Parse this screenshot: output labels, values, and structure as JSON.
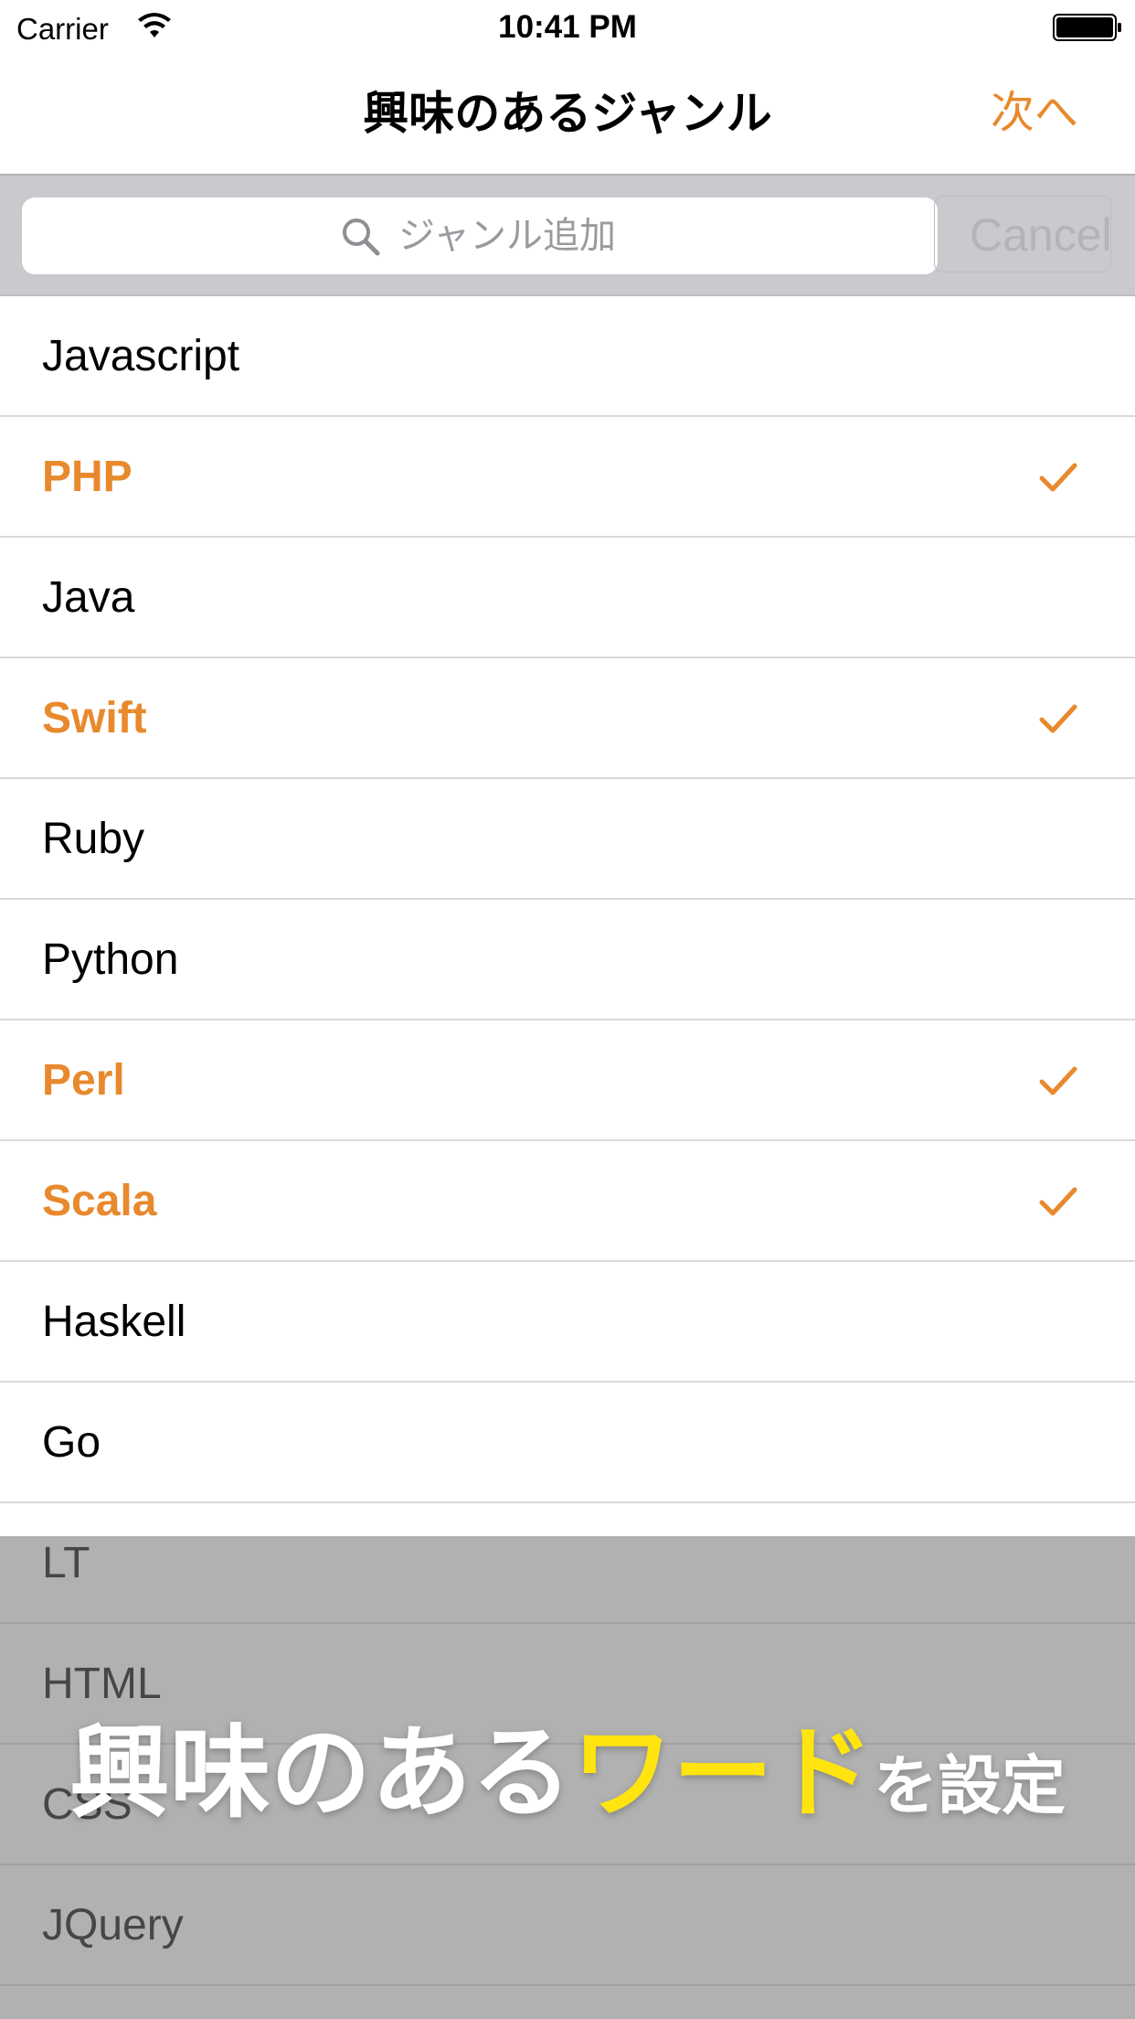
{
  "status_bar": {
    "carrier": "Carrier",
    "time": "10:41 PM"
  },
  "nav": {
    "title": "興味のあるジャンル",
    "next_label": "次へ"
  },
  "search": {
    "placeholder": "ジャンル追加",
    "cancel_label": "Cancel"
  },
  "colors": {
    "accent": "#e8892d",
    "caption_highlight": "#ffe40f"
  },
  "items": [
    {
      "label": "Javascript",
      "selected": false
    },
    {
      "label": "PHP",
      "selected": true
    },
    {
      "label": "Java",
      "selected": false
    },
    {
      "label": "Swift",
      "selected": true
    },
    {
      "label": "Ruby",
      "selected": false
    },
    {
      "label": "Python",
      "selected": false
    },
    {
      "label": "Perl",
      "selected": true
    },
    {
      "label": "Scala",
      "selected": true
    },
    {
      "label": "Haskell",
      "selected": false
    },
    {
      "label": "Go",
      "selected": false
    },
    {
      "label": "LT",
      "selected": false
    },
    {
      "label": "HTML",
      "selected": false
    },
    {
      "label": "CSS",
      "selected": false
    },
    {
      "label": "JQuery",
      "selected": false
    }
  ],
  "caption": {
    "part1": "興味のある",
    "part2": "ワード",
    "part3": "を設定"
  }
}
